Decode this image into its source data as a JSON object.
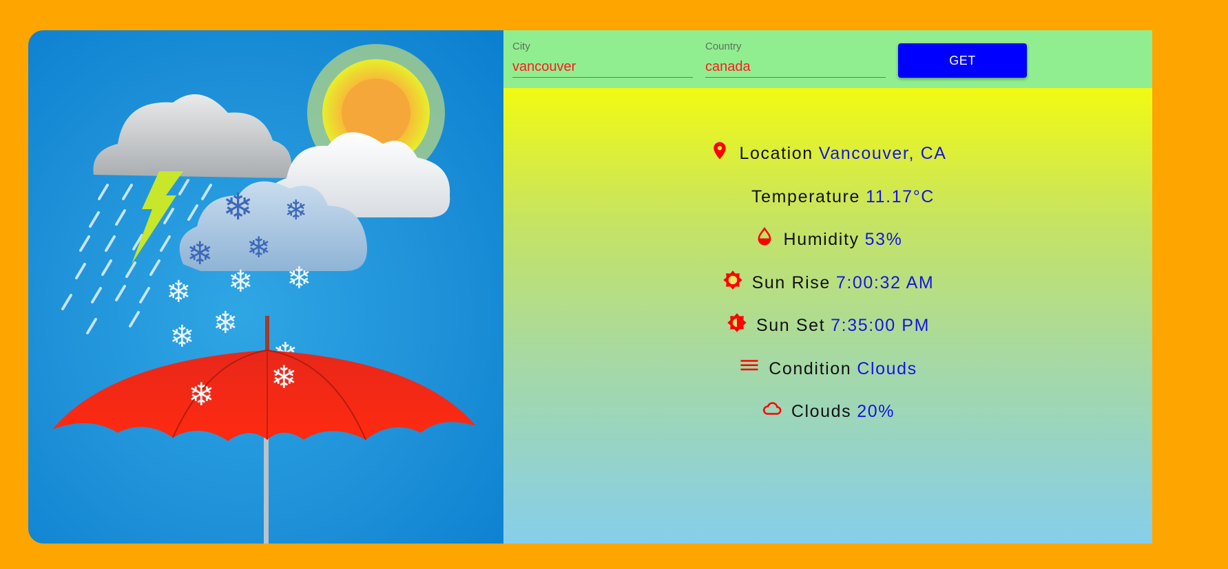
{
  "form": {
    "city_label": "City",
    "city_value": "vancouver",
    "country_label": "Country",
    "country_value": "canada",
    "get_label": "GET"
  },
  "weather": {
    "location": {
      "label": "Location",
      "value": "Vancouver, CA",
      "icon": "map-pin-icon"
    },
    "temperature": {
      "label": "Temperature",
      "value": "11.17°C",
      "icon": "moon-icon"
    },
    "humidity": {
      "label": "Humidity",
      "value": "53%",
      "icon": "water-drop-icon"
    },
    "sunrise": {
      "label": "Sun Rise",
      "value": "7:00:32 AM",
      "icon": "sun-icon"
    },
    "sunset": {
      "label": "Sun Set",
      "value": "7:35:00 PM",
      "icon": "sunset-icon"
    },
    "condition": {
      "label": "Condition",
      "value": "Clouds",
      "icon": "menu-lines-icon"
    },
    "clouds": {
      "label": "Clouds",
      "value": "20%",
      "icon": "cloud-icon"
    }
  },
  "colors": {
    "page_bg": "#FFA500",
    "form_bg": "#90EE90",
    "button": "#0000FF",
    "icon": "#FF0000",
    "value_text": "#1515E0",
    "input_text": "#FF1A1A"
  }
}
